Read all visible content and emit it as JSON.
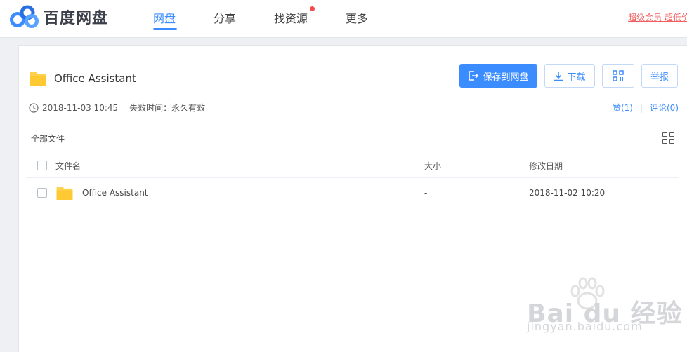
{
  "header": {
    "logo_text": "百度网盘",
    "nav": [
      {
        "label": "网盘",
        "active": true
      },
      {
        "label": "分享",
        "active": false
      },
      {
        "label": "找资源",
        "active": false,
        "has_dot": true
      },
      {
        "label": "更多",
        "active": false
      }
    ],
    "top_right_text": "超级会员 超低价"
  },
  "share": {
    "title": "Office Assistant",
    "buttons": {
      "save": "保存到网盘",
      "download": "下载",
      "report": "举报"
    },
    "date": "2018-11-03 10:45",
    "expire": "失效时间：永久有效",
    "like": "赞(1)",
    "comment": "评论(0)"
  },
  "breadcrumb": "全部文件",
  "table": {
    "columns": [
      "文件名",
      "大小",
      "修改日期"
    ],
    "rows": [
      {
        "name": "Office Assistant",
        "size": "-",
        "modified": "2018-11-02 10:20"
      }
    ]
  },
  "watermark": {
    "brand": "Bai du 经验",
    "url": "jingyan.baidu.com"
  },
  "colors": {
    "accent": "#3b8cff",
    "folder": "#ffd24d",
    "red_dot": "#f24d4d"
  }
}
